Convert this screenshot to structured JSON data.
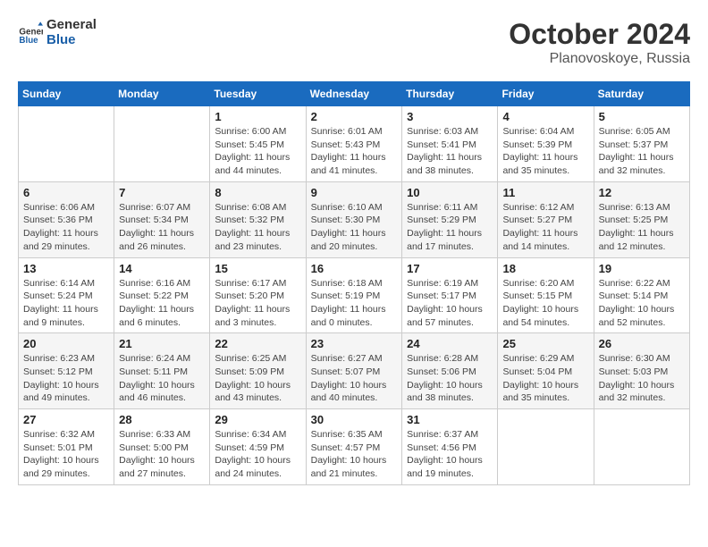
{
  "header": {
    "logo_general": "General",
    "logo_blue": "Blue",
    "month": "October 2024",
    "location": "Planovoskoye, Russia"
  },
  "weekdays": [
    "Sunday",
    "Monday",
    "Tuesday",
    "Wednesday",
    "Thursday",
    "Friday",
    "Saturday"
  ],
  "weeks": [
    [
      {
        "day": "",
        "sunrise": "",
        "sunset": "",
        "daylight": ""
      },
      {
        "day": "",
        "sunrise": "",
        "sunset": "",
        "daylight": ""
      },
      {
        "day": "1",
        "sunrise": "Sunrise: 6:00 AM",
        "sunset": "Sunset: 5:45 PM",
        "daylight": "Daylight: 11 hours and 44 minutes."
      },
      {
        "day": "2",
        "sunrise": "Sunrise: 6:01 AM",
        "sunset": "Sunset: 5:43 PM",
        "daylight": "Daylight: 11 hours and 41 minutes."
      },
      {
        "day": "3",
        "sunrise": "Sunrise: 6:03 AM",
        "sunset": "Sunset: 5:41 PM",
        "daylight": "Daylight: 11 hours and 38 minutes."
      },
      {
        "day": "4",
        "sunrise": "Sunrise: 6:04 AM",
        "sunset": "Sunset: 5:39 PM",
        "daylight": "Daylight: 11 hours and 35 minutes."
      },
      {
        "day": "5",
        "sunrise": "Sunrise: 6:05 AM",
        "sunset": "Sunset: 5:37 PM",
        "daylight": "Daylight: 11 hours and 32 minutes."
      }
    ],
    [
      {
        "day": "6",
        "sunrise": "Sunrise: 6:06 AM",
        "sunset": "Sunset: 5:36 PM",
        "daylight": "Daylight: 11 hours and 29 minutes."
      },
      {
        "day": "7",
        "sunrise": "Sunrise: 6:07 AM",
        "sunset": "Sunset: 5:34 PM",
        "daylight": "Daylight: 11 hours and 26 minutes."
      },
      {
        "day": "8",
        "sunrise": "Sunrise: 6:08 AM",
        "sunset": "Sunset: 5:32 PM",
        "daylight": "Daylight: 11 hours and 23 minutes."
      },
      {
        "day": "9",
        "sunrise": "Sunrise: 6:10 AM",
        "sunset": "Sunset: 5:30 PM",
        "daylight": "Daylight: 11 hours and 20 minutes."
      },
      {
        "day": "10",
        "sunrise": "Sunrise: 6:11 AM",
        "sunset": "Sunset: 5:29 PM",
        "daylight": "Daylight: 11 hours and 17 minutes."
      },
      {
        "day": "11",
        "sunrise": "Sunrise: 6:12 AM",
        "sunset": "Sunset: 5:27 PM",
        "daylight": "Daylight: 11 hours and 14 minutes."
      },
      {
        "day": "12",
        "sunrise": "Sunrise: 6:13 AM",
        "sunset": "Sunset: 5:25 PM",
        "daylight": "Daylight: 11 hours and 12 minutes."
      }
    ],
    [
      {
        "day": "13",
        "sunrise": "Sunrise: 6:14 AM",
        "sunset": "Sunset: 5:24 PM",
        "daylight": "Daylight: 11 hours and 9 minutes."
      },
      {
        "day": "14",
        "sunrise": "Sunrise: 6:16 AM",
        "sunset": "Sunset: 5:22 PM",
        "daylight": "Daylight: 11 hours and 6 minutes."
      },
      {
        "day": "15",
        "sunrise": "Sunrise: 6:17 AM",
        "sunset": "Sunset: 5:20 PM",
        "daylight": "Daylight: 11 hours and 3 minutes."
      },
      {
        "day": "16",
        "sunrise": "Sunrise: 6:18 AM",
        "sunset": "Sunset: 5:19 PM",
        "daylight": "Daylight: 11 hours and 0 minutes."
      },
      {
        "day": "17",
        "sunrise": "Sunrise: 6:19 AM",
        "sunset": "Sunset: 5:17 PM",
        "daylight": "Daylight: 10 hours and 57 minutes."
      },
      {
        "day": "18",
        "sunrise": "Sunrise: 6:20 AM",
        "sunset": "Sunset: 5:15 PM",
        "daylight": "Daylight: 10 hours and 54 minutes."
      },
      {
        "day": "19",
        "sunrise": "Sunrise: 6:22 AM",
        "sunset": "Sunset: 5:14 PM",
        "daylight": "Daylight: 10 hours and 52 minutes."
      }
    ],
    [
      {
        "day": "20",
        "sunrise": "Sunrise: 6:23 AM",
        "sunset": "Sunset: 5:12 PM",
        "daylight": "Daylight: 10 hours and 49 minutes."
      },
      {
        "day": "21",
        "sunrise": "Sunrise: 6:24 AM",
        "sunset": "Sunset: 5:11 PM",
        "daylight": "Daylight: 10 hours and 46 minutes."
      },
      {
        "day": "22",
        "sunrise": "Sunrise: 6:25 AM",
        "sunset": "Sunset: 5:09 PM",
        "daylight": "Daylight: 10 hours and 43 minutes."
      },
      {
        "day": "23",
        "sunrise": "Sunrise: 6:27 AM",
        "sunset": "Sunset: 5:07 PM",
        "daylight": "Daylight: 10 hours and 40 minutes."
      },
      {
        "day": "24",
        "sunrise": "Sunrise: 6:28 AM",
        "sunset": "Sunset: 5:06 PM",
        "daylight": "Daylight: 10 hours and 38 minutes."
      },
      {
        "day": "25",
        "sunrise": "Sunrise: 6:29 AM",
        "sunset": "Sunset: 5:04 PM",
        "daylight": "Daylight: 10 hours and 35 minutes."
      },
      {
        "day": "26",
        "sunrise": "Sunrise: 6:30 AM",
        "sunset": "Sunset: 5:03 PM",
        "daylight": "Daylight: 10 hours and 32 minutes."
      }
    ],
    [
      {
        "day": "27",
        "sunrise": "Sunrise: 6:32 AM",
        "sunset": "Sunset: 5:01 PM",
        "daylight": "Daylight: 10 hours and 29 minutes."
      },
      {
        "day": "28",
        "sunrise": "Sunrise: 6:33 AM",
        "sunset": "Sunset: 5:00 PM",
        "daylight": "Daylight: 10 hours and 27 minutes."
      },
      {
        "day": "29",
        "sunrise": "Sunrise: 6:34 AM",
        "sunset": "Sunset: 4:59 PM",
        "daylight": "Daylight: 10 hours and 24 minutes."
      },
      {
        "day": "30",
        "sunrise": "Sunrise: 6:35 AM",
        "sunset": "Sunset: 4:57 PM",
        "daylight": "Daylight: 10 hours and 21 minutes."
      },
      {
        "day": "31",
        "sunrise": "Sunrise: 6:37 AM",
        "sunset": "Sunset: 4:56 PM",
        "daylight": "Daylight: 10 hours and 19 minutes."
      },
      {
        "day": "",
        "sunrise": "",
        "sunset": "",
        "daylight": ""
      },
      {
        "day": "",
        "sunrise": "",
        "sunset": "",
        "daylight": ""
      }
    ]
  ]
}
